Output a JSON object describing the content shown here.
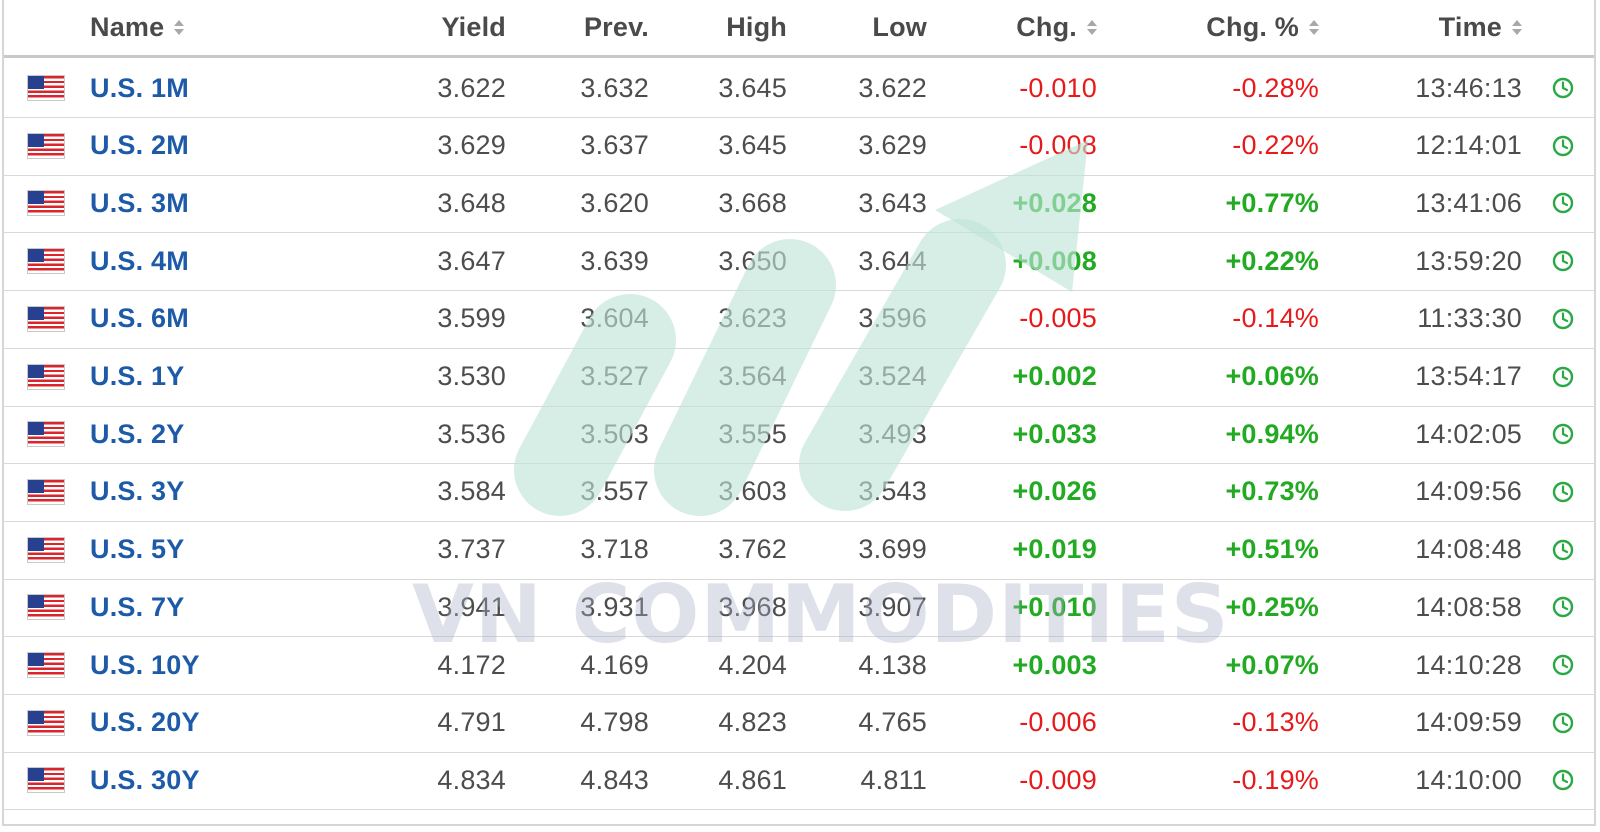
{
  "columns": {
    "name": "Name",
    "yield": "Yield",
    "prev": "Prev.",
    "high": "High",
    "low": "Low",
    "chg": "Chg.",
    "chg_pct": "Chg. %",
    "time": "Time"
  },
  "rows": [
    {
      "name": "U.S. 1M",
      "yield": "3.622",
      "prev": "3.632",
      "high": "3.645",
      "low": "3.622",
      "chg": "-0.010",
      "chg_pct": "-0.28%",
      "time": "13:46:13",
      "direction": "down"
    },
    {
      "name": "U.S. 2M",
      "yield": "3.629",
      "prev": "3.637",
      "high": "3.645",
      "low": "3.629",
      "chg": "-0.008",
      "chg_pct": "-0.22%",
      "time": "12:14:01",
      "direction": "down"
    },
    {
      "name": "U.S. 3M",
      "yield": "3.648",
      "prev": "3.620",
      "high": "3.668",
      "low": "3.643",
      "chg": "+0.028",
      "chg_pct": "+0.77%",
      "time": "13:41:06",
      "direction": "up"
    },
    {
      "name": "U.S. 4M",
      "yield": "3.647",
      "prev": "3.639",
      "high": "3.650",
      "low": "3.644",
      "chg": "+0.008",
      "chg_pct": "+0.22%",
      "time": "13:59:20",
      "direction": "up"
    },
    {
      "name": "U.S. 6M",
      "yield": "3.599",
      "prev": "3.604",
      "high": "3.623",
      "low": "3.596",
      "chg": "-0.005",
      "chg_pct": "-0.14%",
      "time": "11:33:30",
      "direction": "down"
    },
    {
      "name": "U.S. 1Y",
      "yield": "3.530",
      "prev": "3.527",
      "high": "3.564",
      "low": "3.524",
      "chg": "+0.002",
      "chg_pct": "+0.06%",
      "time": "13:54:17",
      "direction": "up"
    },
    {
      "name": "U.S. 2Y",
      "yield": "3.536",
      "prev": "3.503",
      "high": "3.555",
      "low": "3.493",
      "chg": "+0.033",
      "chg_pct": "+0.94%",
      "time": "14:02:05",
      "direction": "up"
    },
    {
      "name": "U.S. 3Y",
      "yield": "3.584",
      "prev": "3.557",
      "high": "3.603",
      "low": "3.543",
      "chg": "+0.026",
      "chg_pct": "+0.73%",
      "time": "14:09:56",
      "direction": "up"
    },
    {
      "name": "U.S. 5Y",
      "yield": "3.737",
      "prev": "3.718",
      "high": "3.762",
      "low": "3.699",
      "chg": "+0.019",
      "chg_pct": "+0.51%",
      "time": "14:08:48",
      "direction": "up"
    },
    {
      "name": "U.S. 7Y",
      "yield": "3.941",
      "prev": "3.931",
      "high": "3.968",
      "low": "3.907",
      "chg": "+0.010",
      "chg_pct": "+0.25%",
      "time": "14:08:58",
      "direction": "up"
    },
    {
      "name": "U.S. 10Y",
      "yield": "4.172",
      "prev": "4.169",
      "high": "4.204",
      "low": "4.138",
      "chg": "+0.003",
      "chg_pct": "+0.07%",
      "time": "14:10:28",
      "direction": "up"
    },
    {
      "name": "U.S. 20Y",
      "yield": "4.791",
      "prev": "4.798",
      "high": "4.823",
      "low": "4.765",
      "chg": "-0.006",
      "chg_pct": "-0.13%",
      "time": "14:09:59",
      "direction": "down"
    },
    {
      "name": "U.S. 30Y",
      "yield": "4.834",
      "prev": "4.843",
      "high": "4.861",
      "low": "4.811",
      "chg": "-0.009",
      "chg_pct": "-0.19%",
      "time": "14:10:00",
      "direction": "down"
    }
  ],
  "icons": {
    "flag": "us-flag-icon",
    "clock": "clock-icon",
    "sort": "sort-arrows-icon"
  },
  "colors": {
    "name_link": "#1d5aa8",
    "negative": "#e61a1a",
    "positive": "#22aa22",
    "clock": "#2aa845",
    "watermark_arrow": "#bfe3d7"
  },
  "watermark": {
    "text": "VN COMMODITIES"
  }
}
